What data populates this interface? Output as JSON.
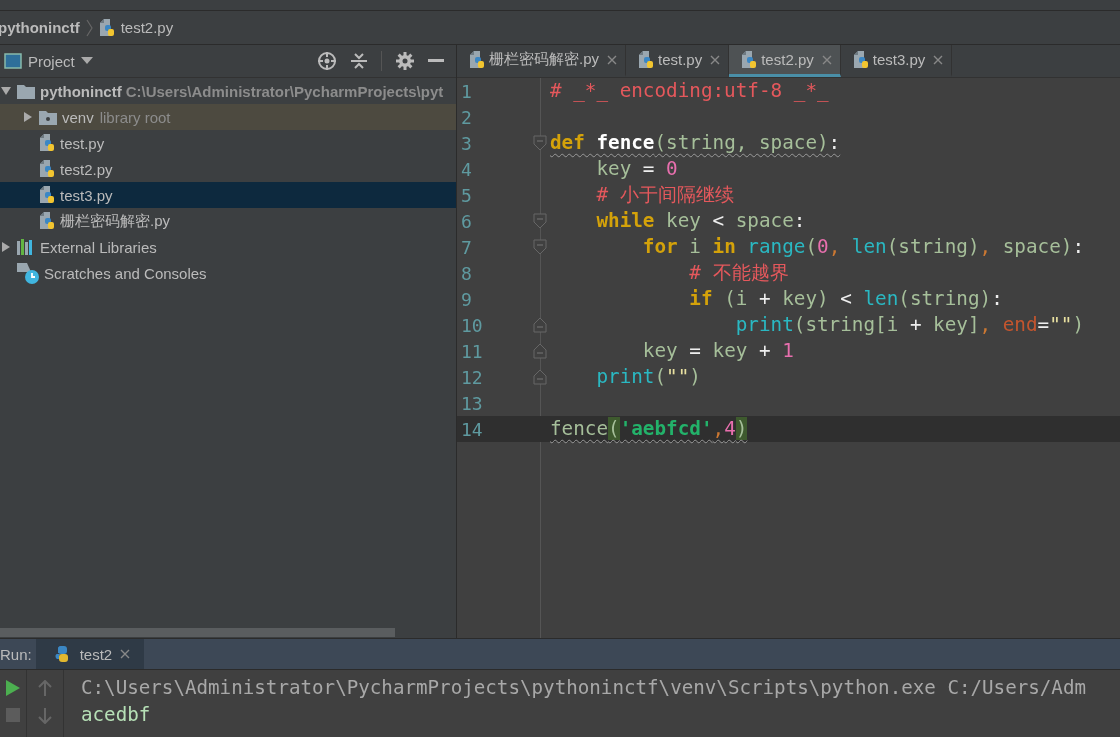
{
  "breadcrumb": {
    "project": "pythoninctf",
    "file": "test2.py"
  },
  "project_panel": {
    "title": "Project",
    "tree": [
      {
        "label": "pythoninctf",
        "path": "C:\\Users\\Administrator\\PycharmProjects\\pyt",
        "kind": "project",
        "expanded": true,
        "selected": false,
        "children": [
          {
            "label": "venv",
            "note": "library root",
            "kind": "library-root",
            "expanded": false,
            "selected": false
          },
          {
            "label": "test.py",
            "kind": "file",
            "selected": false
          },
          {
            "label": "test2.py",
            "kind": "file",
            "selected": false
          },
          {
            "label": "test3.py",
            "kind": "file",
            "selected": true
          },
          {
            "label": "栅栏密码解密.py",
            "kind": "file",
            "selected": false
          }
        ]
      },
      {
        "label": "External Libraries",
        "kind": "libraries",
        "expanded": false,
        "selected": false
      },
      {
        "label": "Scratches and Consoles",
        "kind": "scratches",
        "selected": false
      }
    ]
  },
  "editor": {
    "tabs": [
      {
        "label": "栅栏密码解密.py",
        "selected": false
      },
      {
        "label": "test.py",
        "selected": false
      },
      {
        "label": "test2.py",
        "selected": true
      },
      {
        "label": "test3.py",
        "selected": false
      }
    ],
    "lines": [
      {
        "number": "1",
        "current": false,
        "fold_start": false,
        "fold_end": false,
        "warning": false,
        "tokens": [
          {
            "text": "# _*_ encoding:utf-8 _*_",
            "kind": "comment"
          }
        ]
      },
      {
        "number": "2",
        "current": false,
        "fold_start": false,
        "fold_end": false
      },
      {
        "number": "3",
        "current": false,
        "fold_start": true,
        "fold_end": false,
        "warning": true,
        "tokens": [
          {
            "text": "def",
            "kind": "keyword"
          },
          {
            "text": " fence",
            "kind": "defname"
          },
          {
            "text": "(string, space)",
            "kind": "plain"
          },
          {
            "text": ":",
            "kind": "op"
          }
        ]
      },
      {
        "number": "4",
        "current": false,
        "fold_start": false,
        "fold_end": false,
        "warning": false,
        "tokens": [
          {
            "text": "    key",
            "kind": "plain"
          },
          {
            "text": " = ",
            "kind": "op"
          },
          {
            "text": "0",
            "kind": "number"
          }
        ]
      },
      {
        "number": "5",
        "current": false,
        "fold_start": false,
        "fold_end": false,
        "warning": false,
        "tokens": [
          {
            "text": "    # 小于间隔继续",
            "kind": "comment"
          }
        ]
      },
      {
        "number": "6",
        "current": false,
        "fold_start": true,
        "fold_end": false,
        "warning": false,
        "tokens": [
          {
            "text": "    while",
            "kind": "keyword"
          },
          {
            "text": " key ",
            "kind": "plain"
          },
          {
            "text": "<",
            "kind": "op"
          },
          {
            "text": " space",
            "kind": "plain"
          },
          {
            "text": ":",
            "kind": "op"
          }
        ]
      },
      {
        "number": "7",
        "current": false,
        "fold_start": true,
        "fold_end": false,
        "warning": false,
        "tokens": [
          {
            "text": "        for",
            "kind": "keyword"
          },
          {
            "text": " i ",
            "kind": "plain"
          },
          {
            "text": "in",
            "kind": "keyword"
          },
          {
            "text": " range",
            "kind": "builtin"
          },
          {
            "text": "(",
            "kind": "plain"
          },
          {
            "text": "0",
            "kind": "number"
          },
          {
            "text": ", ",
            "kind": "comma"
          },
          {
            "text": "len",
            "kind": "builtin"
          },
          {
            "text": "(string)",
            "kind": "plain"
          },
          {
            "text": ", ",
            "kind": "comma"
          },
          {
            "text": "space)",
            "kind": "plain"
          },
          {
            "text": ":",
            "kind": "op"
          }
        ]
      },
      {
        "number": "8",
        "current": false,
        "fold_start": false,
        "fold_end": false,
        "warning": false,
        "tokens": [
          {
            "text": "            # 不能越界",
            "kind": "comment"
          }
        ]
      },
      {
        "number": "9",
        "current": false,
        "fold_start": false,
        "fold_end": false,
        "warning": false,
        "tokens": [
          {
            "text": "            if",
            "kind": "keyword"
          },
          {
            "text": " (i ",
            "kind": "plain"
          },
          {
            "text": "+",
            "kind": "op"
          },
          {
            "text": " key) ",
            "kind": "plain"
          },
          {
            "text": "<",
            "kind": "op"
          },
          {
            "text": " len",
            "kind": "builtin"
          },
          {
            "text": "(string)",
            "kind": "plain"
          },
          {
            "text": ":",
            "kind": "op"
          }
        ]
      },
      {
        "number": "10",
        "current": false,
        "fold_start": false,
        "fold_end": true,
        "warning": false,
        "tokens": [
          {
            "text": "                print",
            "kind": "builtin"
          },
          {
            "text": "(string[i ",
            "kind": "plain"
          },
          {
            "text": "+",
            "kind": "op"
          },
          {
            "text": " key]",
            "kind": "plain"
          },
          {
            "text": ", ",
            "kind": "comma"
          },
          {
            "text": "end",
            "kind": "kwarg"
          },
          {
            "text": "=",
            "kind": "op"
          },
          {
            "text": "\"\"",
            "kind": "string"
          },
          {
            "text": ")",
            "kind": "plain"
          }
        ]
      },
      {
        "number": "11",
        "current": false,
        "fold_start": false,
        "fold_end": true,
        "warning": false,
        "tokens": [
          {
            "text": "        key",
            "kind": "plain"
          },
          {
            "text": " = ",
            "kind": "op"
          },
          {
            "text": "key ",
            "kind": "plain"
          },
          {
            "text": "+",
            "kind": "op"
          },
          {
            "text": " 1",
            "kind": "number"
          }
        ]
      },
      {
        "number": "12",
        "current": false,
        "fold_start": false,
        "fold_end": true,
        "warning": false,
        "tokens": [
          {
            "text": "    print",
            "kind": "builtin"
          },
          {
            "text": "(",
            "kind": "plain"
          },
          {
            "text": "\"\"",
            "kind": "string"
          },
          {
            "text": ")",
            "kind": "plain"
          }
        ]
      },
      {
        "number": "13",
        "current": false,
        "fold_start": false,
        "fold_end": false
      },
      {
        "number": "14",
        "current": true,
        "fold_start": false,
        "fold_end": false,
        "warning": true,
        "tokens": [
          {
            "text": "fence",
            "kind": "plain"
          },
          {
            "text": "(",
            "kind": "brace"
          },
          {
            "text": "'aebfcd'",
            "kind": "bold-string"
          },
          {
            "text": ",",
            "kind": "comma"
          },
          {
            "text": "4",
            "kind": "number"
          },
          {
            "text": ")",
            "kind": "brace"
          }
        ]
      }
    ]
  },
  "run_panel": {
    "label": "Run:",
    "tabs": [
      {
        "label": "test2",
        "selected": true
      }
    ],
    "console": [
      {
        "text": "C:\\Users\\Administrator\\PycharmProjects\\pythoninctf\\venv\\Scripts\\python.exe C:/Users/Adm",
        "kind": "command"
      },
      {
        "text": "acedbf",
        "kind": "output"
      }
    ]
  }
}
